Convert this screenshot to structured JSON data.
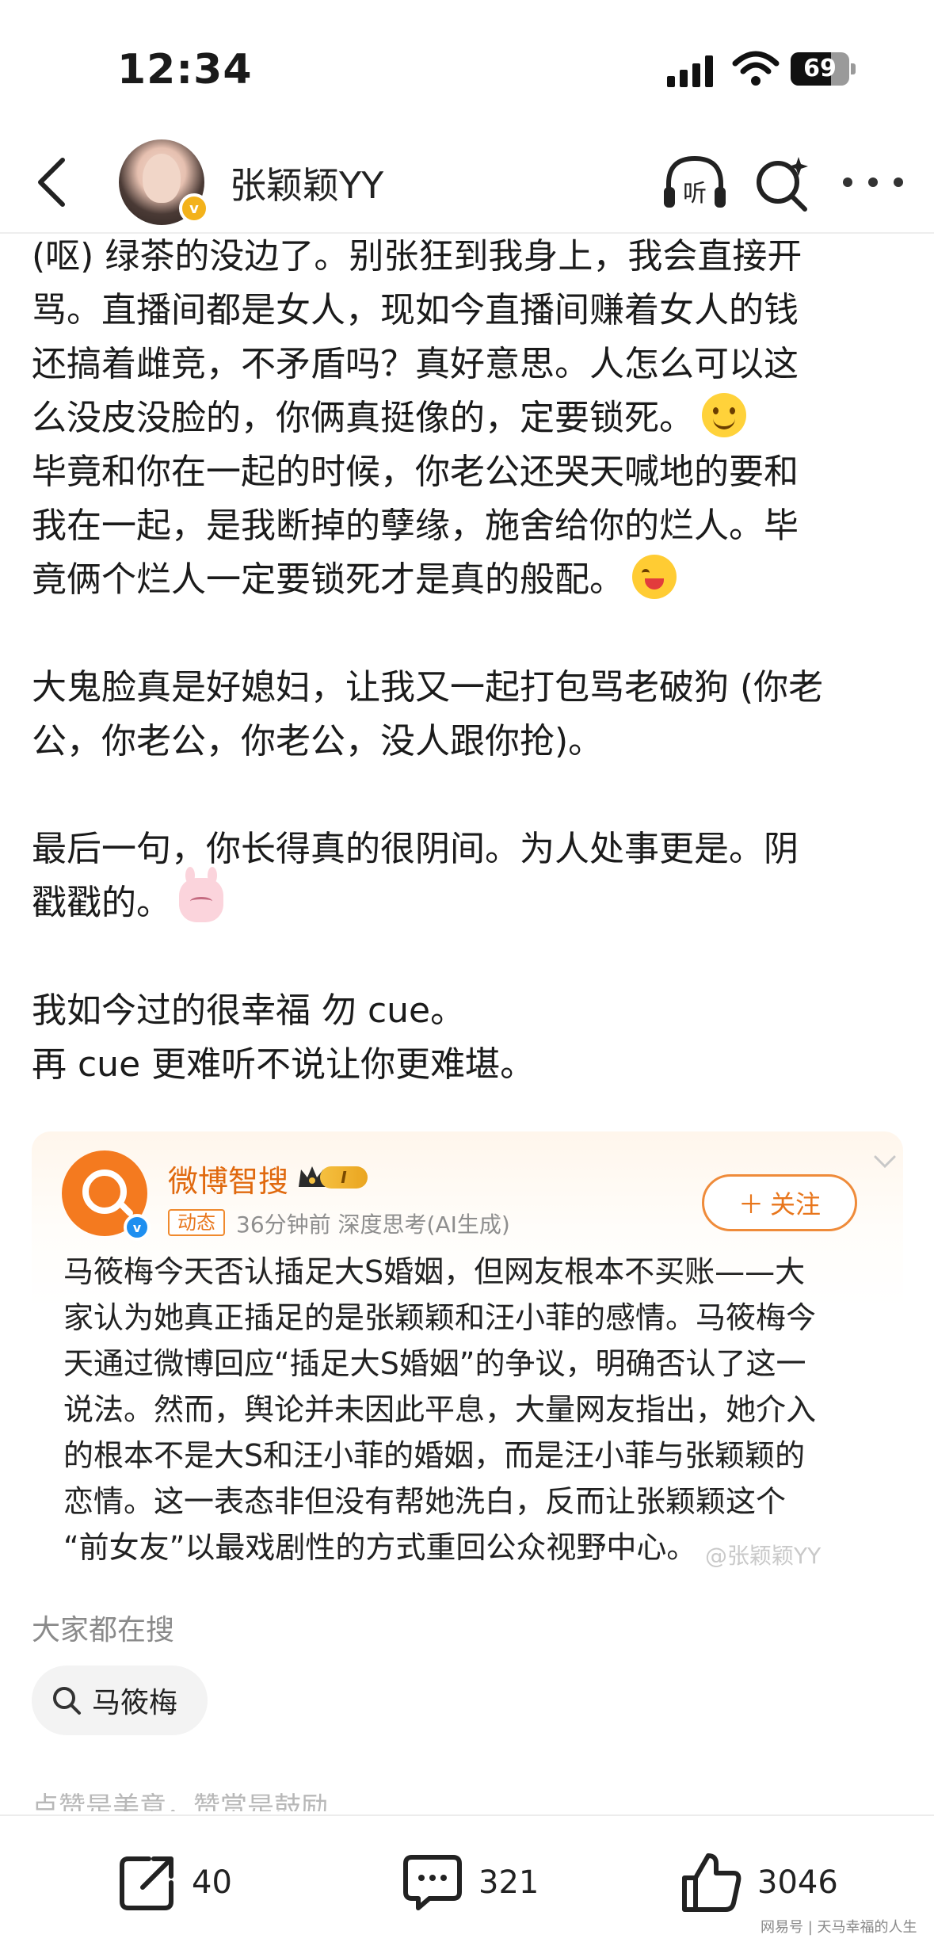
{
  "status_bar": {
    "time": "12:34",
    "battery_percent": "69"
  },
  "header": {
    "username": "张颖颖YY",
    "icons": [
      "back-icon",
      "listen-icon",
      "ai-search-icon",
      "more-icon"
    ],
    "listen_label": "听"
  },
  "post": {
    "paragraphs": [
      [
        "(呕) 绿茶的没边了。别张狂到我身上，我会直接开",
        "骂。直播间都是女人，现如今直播间赚着女人的钱",
        "还搞着雌竞，不矛盾吗？真好意思。人怎么可以这",
        "么没皮没脸的，你俩真挺像的，定要锁死。",
        "毕竟和你在一起的时候，你老公还哭天喊地的要和",
        "我在一起，是我断掉的孽缘，施舍给你的烂人。毕",
        "竟俩个烂人一定要锁死才是真的般配。"
      ],
      [
        "大鬼脸真是好媳妇，让我又一起打包骂老破狗 (你老",
        "公，你老公，你老公，没人跟你抢)。"
      ],
      [
        "最后一句，你长得真的很阴间。为人处事更是。阴",
        "戳戳的。"
      ],
      [
        "我如今过的很幸福 勿 cue。",
        "再 cue 更难听不说让你更难堪。"
      ]
    ],
    "emojis": [
      "smile-emoji",
      "hug-emoji",
      "bunny-emoji"
    ]
  },
  "ai_card": {
    "name": "微博智搜",
    "level": "I",
    "tag": "动态",
    "meta": "36分钟前 深度思考(AI生成)",
    "follow_label": "关注",
    "lines": [
      "马筱梅今天否认插足大S婚姻，但网友根本不买账——大",
      "家认为她真正插足的是张颖颖和汪小菲的感情。马筱梅今",
      "天通过微博回应“插足大S婚姻”的争议，明确否认了这一",
      "说法。然而，舆论并未因此平息，大量网友指出，她介入",
      "的根本不是大S和汪小菲的婚姻，而是汪小菲与张颖颖的",
      "恋情。这一表态非但没有帮她洗白，反而让张颖颖这个",
      "“前女友”以最戏剧性的方式重回公众视野中心。"
    ],
    "watermark": "@张颖颖YY",
    "colors": {
      "accent": "#f47a1f",
      "verified": "#1e8ff0"
    }
  },
  "search": {
    "title": "大家都在搜",
    "chip": "马筱梅"
  },
  "reward_text": "点赞是美意，赞赏是鼓励",
  "bottom_bar": {
    "repost_count": "40",
    "comment_count": "321",
    "like_count": "3046"
  },
  "footer_brand": "网易号 | 天马幸福的人生"
}
